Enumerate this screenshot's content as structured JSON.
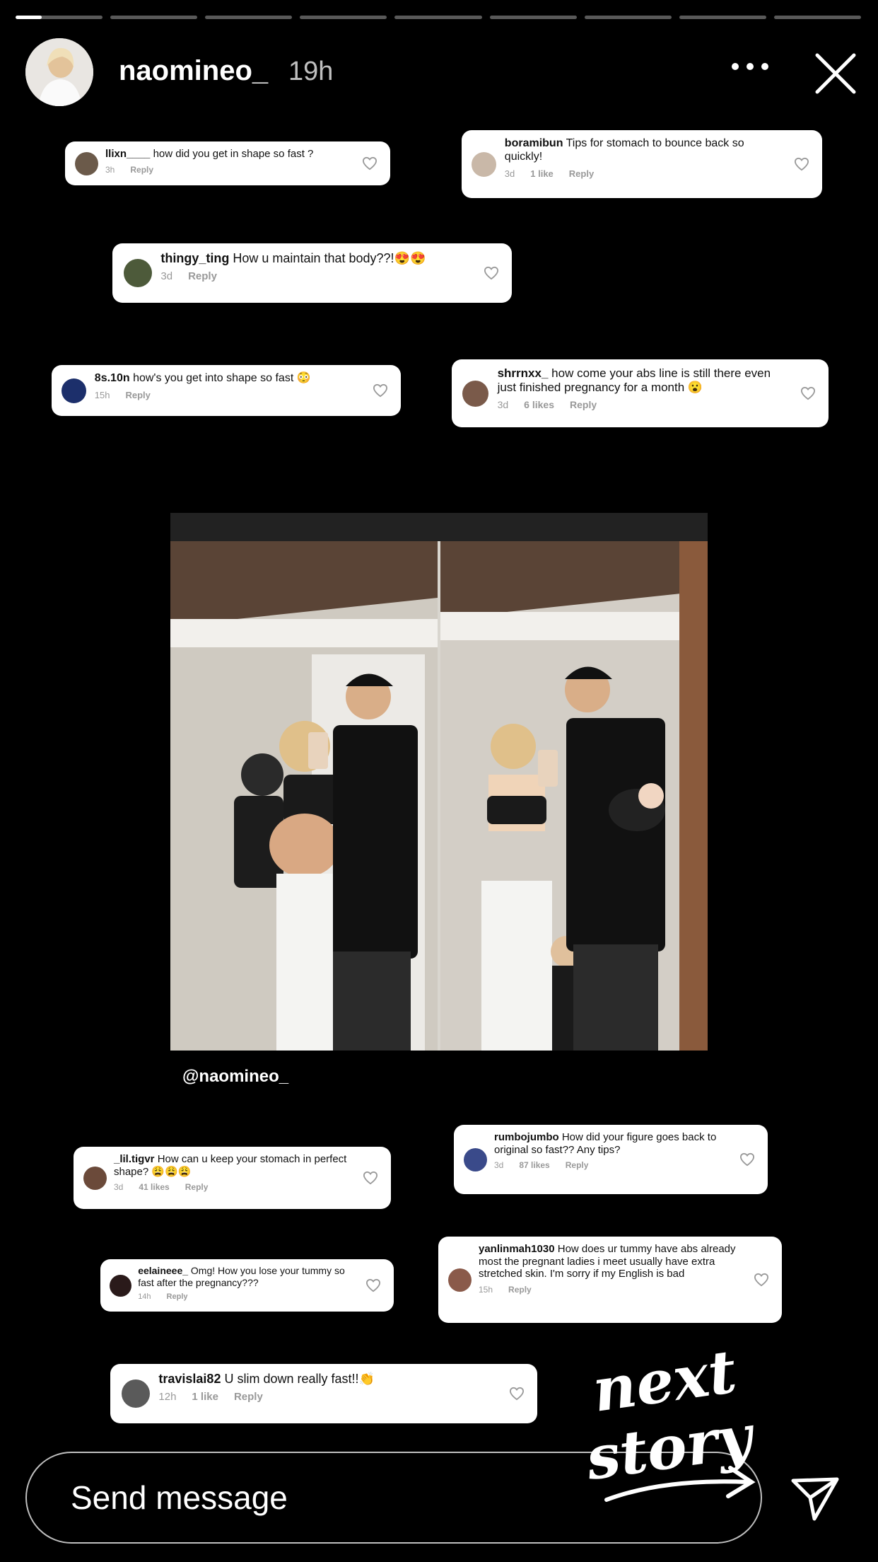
{
  "story": {
    "progress_segments": 9,
    "active_segment_fill": [
      0.3,
      0,
      0,
      0,
      0,
      0,
      0,
      0,
      0
    ]
  },
  "header": {
    "username": "naomineo_",
    "time": "19h"
  },
  "comments": [
    {
      "user": "llixn____",
      "text": "how did you get in shape so fast ?",
      "time": "3h",
      "likes": "",
      "reply": "Reply"
    },
    {
      "user": "boramibun",
      "text": "Tips for stomach to bounce back so quickly!",
      "time": "3d",
      "likes": "1 like",
      "reply": "Reply"
    },
    {
      "user": "thingy_ting",
      "text": "How u maintain that body??!😍😍",
      "time": "3d",
      "likes": "",
      "reply": "Reply"
    },
    {
      "user": "8s.10n",
      "text": "how's you get into shape so fast 😳",
      "time": "15h",
      "likes": "",
      "reply": "Reply"
    },
    {
      "user": "shrrnxx_",
      "text": "how come your abs line is still there even just finished pregnancy for a month 😮",
      "time": "3d",
      "likes": "6 likes",
      "reply": "Reply"
    },
    {
      "user": "_lil.tigvr",
      "text": "How can u keep your stomach in perfect shape? 😩😩😩",
      "time": "3d",
      "likes": "41 likes",
      "reply": "Reply"
    },
    {
      "user": "rumbojumbo",
      "text": "How did your figure goes back to original so fast?? Any tips?",
      "time": "3d",
      "likes": "87 likes",
      "reply": "Reply"
    },
    {
      "user": "eelaineee_",
      "text": "Omg! How you lose your tummy so fast after the pregnancy???",
      "time": "14h",
      "likes": "",
      "reply": "Reply"
    },
    {
      "user": "yanlinmah1030",
      "text": "How does ur tummy have abs already most the pregnant ladies i meet usually have extra stretched skin. I'm sorry if my English is bad",
      "time": "15h",
      "likes": "",
      "reply": "Reply"
    },
    {
      "user": "travislai82",
      "text": "U slim down really fast!!👏",
      "time": "12h",
      "likes": "1 like",
      "reply": "Reply"
    }
  ],
  "photo": {
    "handle": "@naomineo_"
  },
  "composer": {
    "placeholder": "Send message"
  },
  "sticker": {
    "line1": "next",
    "line2": "story"
  },
  "icons": {
    "more": "more-horizontal-icon",
    "close": "close-icon",
    "send": "send-paper-plane-icon",
    "heart": "heart-outline-icon"
  }
}
